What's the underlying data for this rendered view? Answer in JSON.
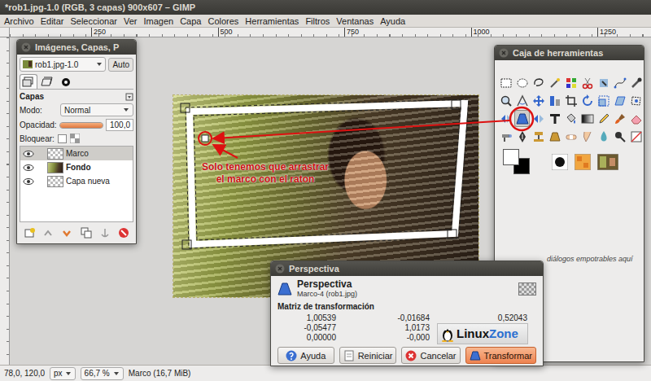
{
  "window": {
    "title": "*rob1.jpg-1.0 (RGB, 3 capas) 900x607 – GIMP"
  },
  "menu": [
    "Archivo",
    "Editar",
    "Seleccionar",
    "Ver",
    "Imagen",
    "Capa",
    "Colores",
    "Herramientas",
    "Filtros",
    "Ventanas",
    "Ayuda"
  ],
  "ruler": {
    "ticks": [
      "250",
      "500",
      "750",
      "1000",
      "1250"
    ]
  },
  "layers_dock": {
    "title": "Imágenes, Capas, P",
    "image": "rob1.jpg-1.0",
    "auto": "Auto",
    "tabs": [
      {
        "selected": true
      },
      {
        "selected": false
      },
      {
        "selected": false
      }
    ],
    "section": "Capas",
    "mode_label": "Modo:",
    "mode": "Normal",
    "opacity_label": "Opacidad:",
    "opacity": "100,0",
    "opacity_level": 1,
    "lock_label": "Bloquear:",
    "lock_checked": false,
    "layers": [
      {
        "name": "Marco",
        "selected": true,
        "visible": true,
        "kind": "transparent",
        "bold": false
      },
      {
        "name": "Fondo",
        "selected": false,
        "visible": true,
        "kind": "photo",
        "bold": true
      },
      {
        "name": "Capa nueva",
        "selected": false,
        "visible": true,
        "kind": "transparent",
        "bold": false
      }
    ]
  },
  "canvas": {
    "annotation": [
      "Solo tenemos que arrastrar",
      "el marco con el raton"
    ]
  },
  "toolbox": {
    "title": "Caja de herramientas",
    "tools": [
      {
        "selected": false
      },
      {
        "selected": false
      },
      {
        "selected": false
      },
      {
        "selected": false
      },
      {
        "selected": false
      },
      {
        "selected": false
      },
      {
        "selected": false
      },
      {
        "selected": false
      },
      {
        "selected": false
      },
      {
        "selected": false
      },
      {
        "selected": false
      },
      {
        "selected": false
      },
      {
        "selected": false
      },
      {
        "selected": false
      },
      {
        "selected": false
      },
      {
        "selected": false
      },
      {
        "selected": false
      },
      {
        "selected": false
      },
      {
        "selected": false
      },
      {
        "selected": true
      },
      {
        "selected": false
      },
      {
        "selected": false
      },
      {
        "selected": false
      },
      {
        "selected": false
      },
      {
        "selected": false
      },
      {
        "selected": false
      },
      {
        "selected": false
      },
      {
        "selected": false
      },
      {
        "selected": false
      },
      {
        "selected": false
      },
      {
        "selected": false
      },
      {
        "selected": false
      },
      {
        "selected": false
      },
      {
        "selected": false
      },
      {
        "selected": false
      },
      {
        "selected": false
      }
    ],
    "foreground": "#ffffff",
    "background": "#000000",
    "hint": "diálogos empotrables aquí"
  },
  "dialog": {
    "title": "Perspectiva",
    "heading": "Perspectiva",
    "subtitle": "Marco-4 (rob1.jpg)",
    "matrix_label": "Matriz de transformación",
    "matrix": [
      [
        "1,00539",
        "-0,01684",
        "0,52043"
      ],
      [
        "-0,05477",
        "1,0173"
      ],
      [
        "0,00000",
        "-0,000"
      ]
    ],
    "buttons": [
      {
        "label": "Ayuda",
        "kind": "help"
      },
      {
        "label": "Reiniciar",
        "kind": "reset"
      },
      {
        "label": "Cancelar",
        "kind": "cancel"
      },
      {
        "label": "Transformar",
        "kind": "default"
      }
    ],
    "watermark": {
      "brand": "Linux",
      "brand2": "Zone"
    }
  },
  "status_bar": {
    "coords": "78,0, 120,0",
    "unit": "px",
    "zoom": "66,7 %",
    "message": "Marco (16,7 MiB)"
  }
}
